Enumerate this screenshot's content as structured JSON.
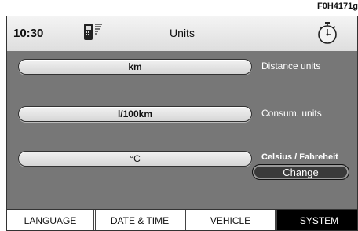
{
  "figure_code": "F0H4171g",
  "status_bar": {
    "time": "10:30",
    "title": "Units",
    "left_icon": "phone-signal-icon",
    "right_icon": "stopwatch-icon"
  },
  "rows": [
    {
      "value": "km",
      "label": "Distance units"
    },
    {
      "value": "l/100km",
      "label": "Consum. units"
    },
    {
      "value": "°C",
      "label": "Celsius / Fahreheit"
    }
  ],
  "change_button": "Change",
  "tabs": [
    {
      "label": "LANGUAGE"
    },
    {
      "label": "DATE & TIME"
    },
    {
      "label": "VEHICLE"
    },
    {
      "label": "SYSTEM",
      "active": true
    }
  ]
}
